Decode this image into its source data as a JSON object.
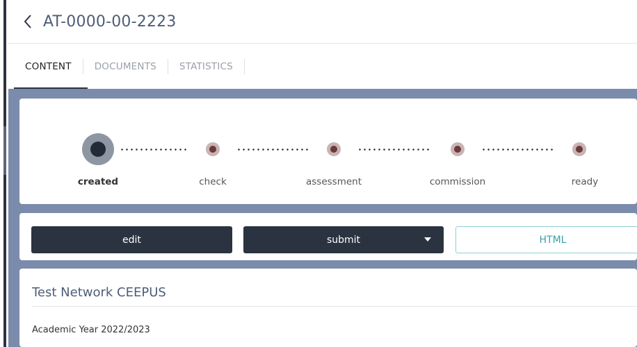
{
  "header": {
    "title": "AT-0000-00-2223"
  },
  "tabs": [
    {
      "label": "CONTENT",
      "active": true
    },
    {
      "label": "DOCUMENTS",
      "active": false
    },
    {
      "label": "STATISTICS",
      "active": false
    }
  ],
  "stepper": {
    "steps": [
      {
        "label": "created",
        "current": true
      },
      {
        "label": "check",
        "current": false
      },
      {
        "label": "assessment",
        "current": false
      },
      {
        "label": "commission",
        "current": false
      },
      {
        "label": "ready",
        "current": false
      }
    ]
  },
  "actions": {
    "edit_label": "edit",
    "submit_label": "submit",
    "html_label": "HTML"
  },
  "info": {
    "network_title": "Test Network CEEPUS",
    "academic_year": "Academic Year 2022/2023"
  },
  "colors": {
    "dark": "#2b3340",
    "accent_teal": "#3aa0a8",
    "background_blue": "#7b8bab",
    "title": "#4e5d76"
  }
}
